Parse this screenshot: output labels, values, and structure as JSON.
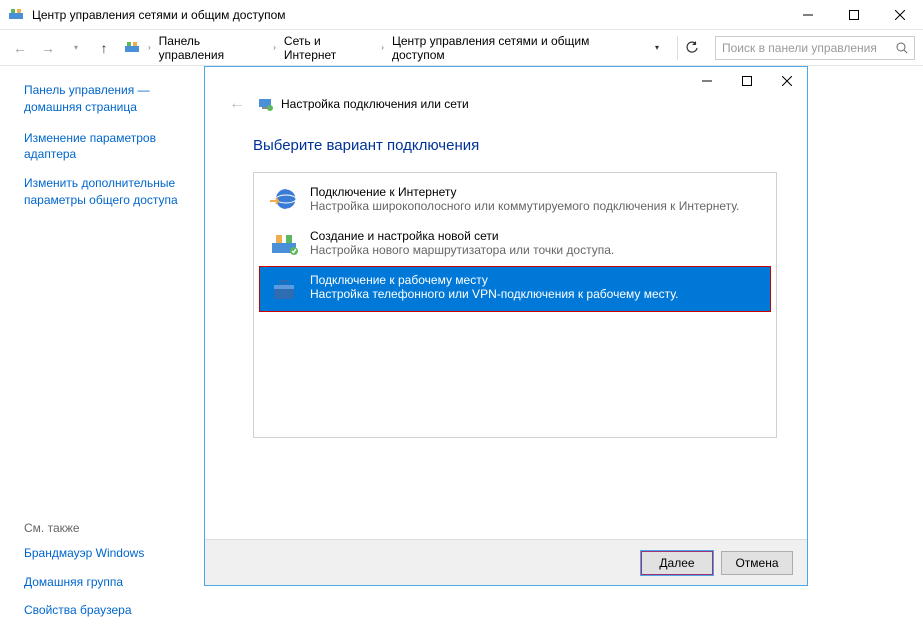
{
  "titlebar": {
    "title": "Центр управления сетями и общим доступом"
  },
  "breadcrumb": {
    "items": [
      "Панель управления",
      "Сеть и Интернет",
      "Центр управления сетями и общим доступом"
    ]
  },
  "search": {
    "placeholder": "Поиск в панели управления"
  },
  "sidebar": {
    "home": "Панель управления — домашняя страница",
    "links": [
      "Изменение параметров адаптера",
      "Изменить дополнительные параметры общего доступа"
    ],
    "see_also_title": "См. также",
    "see_also": [
      "Брандмауэр Windows",
      "Домашняя группа",
      "Свойства браузера"
    ]
  },
  "dialog": {
    "header": "Настройка подключения или сети",
    "heading": "Выберите вариант подключения",
    "options": [
      {
        "title": "Подключение к Интернету",
        "desc": "Настройка широкополосного или коммутируемого подключения к Интернету."
      },
      {
        "title": "Создание и настройка новой сети",
        "desc": "Настройка нового маршрутизатора или точки доступа."
      },
      {
        "title": "Подключение к рабочему месту",
        "desc": "Настройка телефонного или VPN-подключения к рабочему месту."
      }
    ],
    "next": "Далее",
    "cancel": "Отмена"
  }
}
